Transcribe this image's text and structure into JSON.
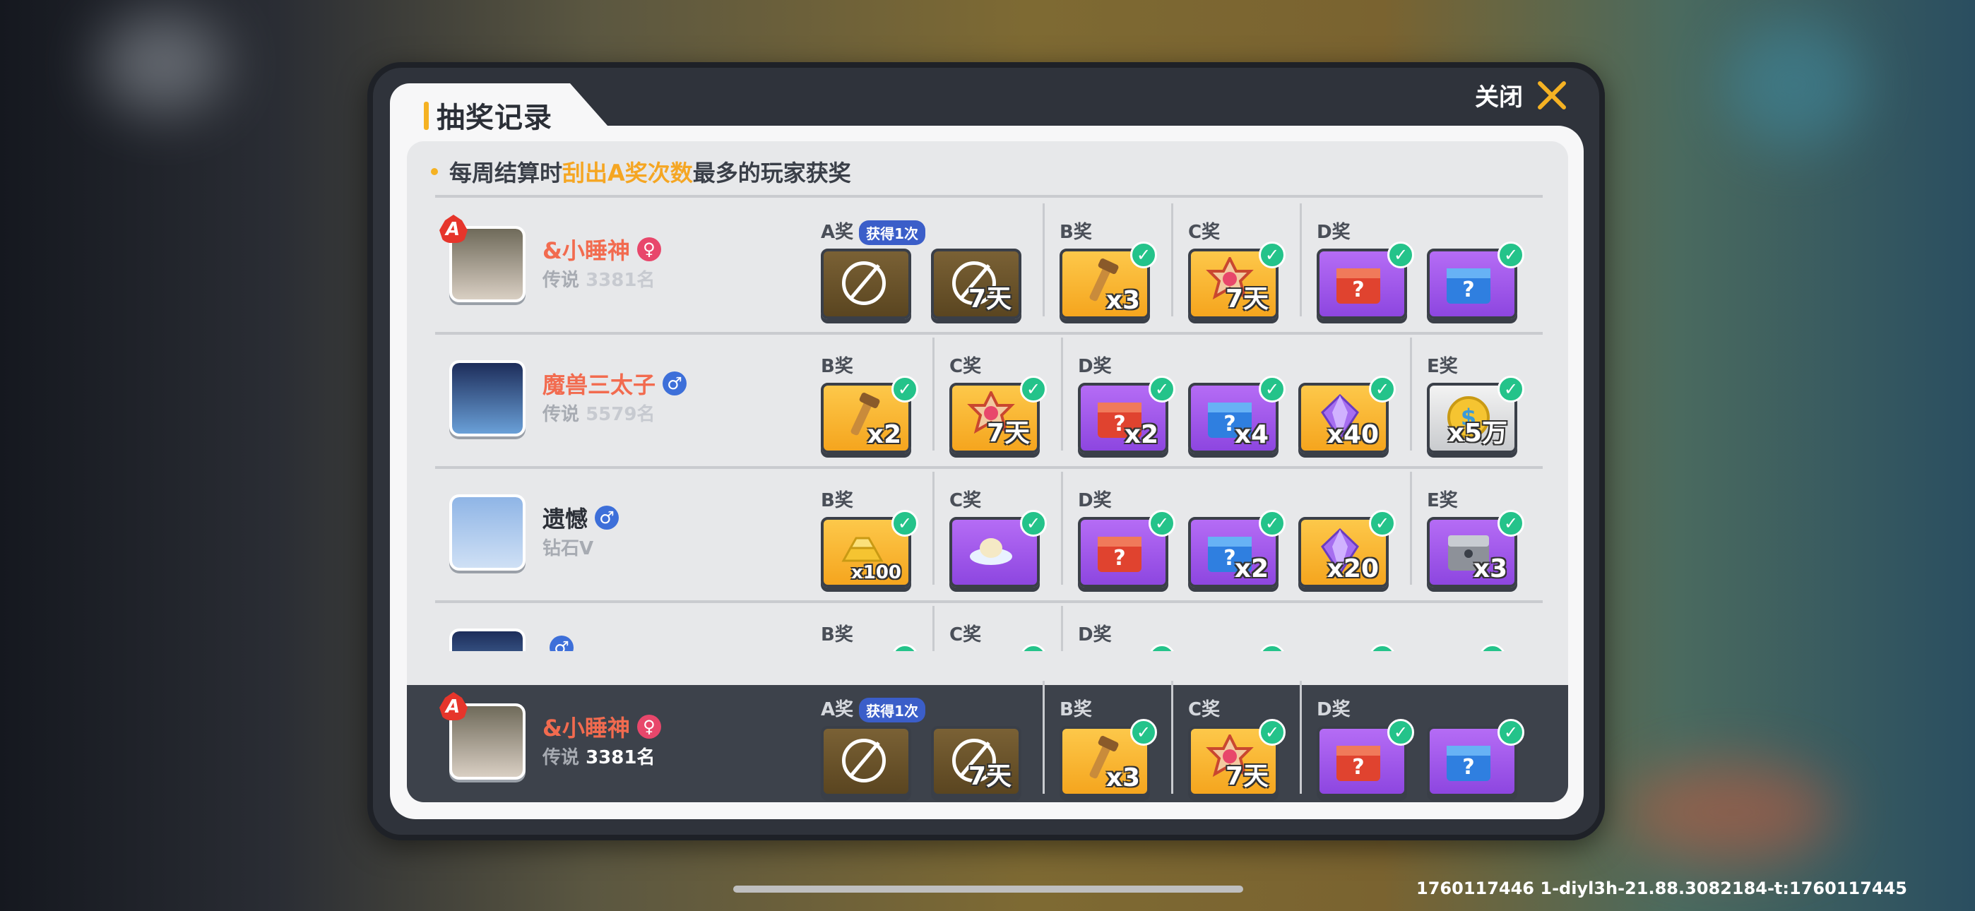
{
  "dialog": {
    "title": "抽奖记录",
    "close_label": "关闭",
    "notice": {
      "before": "每周结算时",
      "highlight": "刮出A奖次数",
      "after": "最多的玩家获奖"
    }
  },
  "players": [
    {
      "name": "&小睡神",
      "gender": "female",
      "gender_glyph": "♀",
      "tier": "传说",
      "rank": "3381名",
      "a_badge": true,
      "name_color": "#f26b4f",
      "groups": [
        {
          "label": "A奖",
          "badge": "获得1次",
          "items": [
            {
              "kind": "dark",
              "icon": "banned-icon",
              "qty": ""
            },
            {
              "kind": "dark",
              "icon": "banned-icon",
              "qty": "7天"
            }
          ]
        },
        {
          "label": "B奖",
          "items": [
            {
              "kind": "gold",
              "icon": "wrench-icon",
              "qty": "x3",
              "checked": true
            }
          ]
        },
        {
          "label": "C奖",
          "items": [
            {
              "kind": "gold",
              "icon": "emblem-icon",
              "qty": "7天",
              "checked": true
            }
          ]
        },
        {
          "label": "D奖",
          "items": [
            {
              "kind": "purple",
              "icon": "red-mystery-box-icon",
              "qty": "",
              "checked": true
            },
            {
              "kind": "purple",
              "icon": "blue-mystery-box-icon",
              "qty": "",
              "checked": true
            }
          ]
        }
      ]
    },
    {
      "name": "魔兽三太子",
      "gender": "male",
      "gender_glyph": "♂",
      "tier": "传说",
      "rank": "5579名",
      "a_badge": false,
      "name_color": "#f26b4f",
      "groups": [
        {
          "label": "B奖",
          "items": [
            {
              "kind": "gold",
              "icon": "wrench-icon",
              "qty": "x2",
              "checked": true
            }
          ]
        },
        {
          "label": "C奖",
          "items": [
            {
              "kind": "gold",
              "icon": "emblem-icon",
              "qty": "7天",
              "checked": true
            }
          ]
        },
        {
          "label": "D奖",
          "items": [
            {
              "kind": "purple",
              "icon": "red-mystery-box-icon",
              "qty": "x2",
              "checked": true
            },
            {
              "kind": "purple",
              "icon": "blue-mystery-box-icon",
              "qty": "x4",
              "checked": true
            },
            {
              "kind": "gold",
              "icon": "crystal-icon",
              "qty": "x40",
              "checked": true
            }
          ]
        },
        {
          "label": "E奖",
          "items": [
            {
              "kind": "grey",
              "icon": "coin-icon",
              "qty": "x5万",
              "checked": true
            }
          ]
        }
      ]
    },
    {
      "name": "遗憾",
      "gender": "male",
      "gender_glyph": "♂",
      "tier": "钻石V",
      "rank": "",
      "a_badge": false,
      "name_color": "#2b2f37",
      "groups": [
        {
          "label": "B奖",
          "items": [
            {
              "kind": "gold",
              "icon": "gold-bar-icon",
              "qty": "x100",
              "checked": true
            }
          ]
        },
        {
          "label": "C奖",
          "items": [
            {
              "kind": "purple",
              "icon": "cloud-icon",
              "qty": "",
              "checked": true
            }
          ]
        },
        {
          "label": "D奖",
          "items": [
            {
              "kind": "purple",
              "icon": "red-mystery-box-icon",
              "qty": "",
              "checked": true
            },
            {
              "kind": "purple",
              "icon": "blue-mystery-box-icon",
              "qty": "x2",
              "checked": true
            },
            {
              "kind": "gold",
              "icon": "crystal-icon",
              "qty": "x20",
              "checked": true
            }
          ]
        },
        {
          "label": "E奖",
          "items": [
            {
              "kind": "purple",
              "icon": "silver-chest-icon",
              "qty": "x3",
              "checked": true
            }
          ]
        }
      ]
    },
    {
      "name": "",
      "gender": "male",
      "gender_glyph": "♂",
      "tier": "",
      "rank": "",
      "a_badge": false,
      "name_color": "#2b2f37",
      "groups": [
        {
          "label": "B奖",
          "items": [
            {
              "kind": "gold",
              "icon": "",
              "qty": "",
              "checked": true
            }
          ]
        },
        {
          "label": "C奖",
          "items": [
            {
              "kind": "purple",
              "icon": "",
              "qty": "",
              "checked": true
            }
          ]
        },
        {
          "label": "D奖",
          "items": [
            {
              "kind": "purple",
              "icon": "",
              "qty": "",
              "checked": true
            },
            {
              "kind": "purple",
              "icon": "",
              "qty": "",
              "checked": true
            },
            {
              "kind": "gold",
              "icon": "",
              "qty": "",
              "checked": true
            },
            {
              "kind": "purple",
              "icon": "",
              "qty": "",
              "checked": true
            }
          ]
        }
      ]
    }
  ],
  "self": {
    "name": "&小睡神",
    "gender": "female",
    "gender_glyph": "♀",
    "tier": "传说",
    "rank": "3381名",
    "a_badge": true,
    "name_color": "#f26b4f",
    "groups": [
      {
        "label": "A奖",
        "badge": "获得1次",
        "items": [
          {
            "kind": "dark",
            "icon": "banned-icon",
            "qty": ""
          },
          {
            "kind": "dark",
            "icon": "banned-icon",
            "qty": "7天"
          }
        ]
      },
      {
        "label": "B奖",
        "items": [
          {
            "kind": "gold",
            "icon": "wrench-icon",
            "qty": "x3",
            "checked": true
          }
        ]
      },
      {
        "label": "C奖",
        "items": [
          {
            "kind": "gold",
            "icon": "emblem-icon",
            "qty": "7天",
            "checked": true
          }
        ]
      },
      {
        "label": "D奖",
        "items": [
          {
            "kind": "purple",
            "icon": "red-mystery-box-icon",
            "qty": "",
            "checked": true
          },
          {
            "kind": "purple",
            "icon": "blue-mystery-box-icon",
            "qty": "",
            "checked": true
          }
        ]
      }
    ]
  },
  "footer": {
    "version": "1760117446  1-diyl3h-21.88.3082184-t:1760117445"
  },
  "colors": {
    "accent": "#f5b223",
    "female": "#e8476b",
    "male": "#3d6fd9",
    "check": "#24c38a"
  }
}
